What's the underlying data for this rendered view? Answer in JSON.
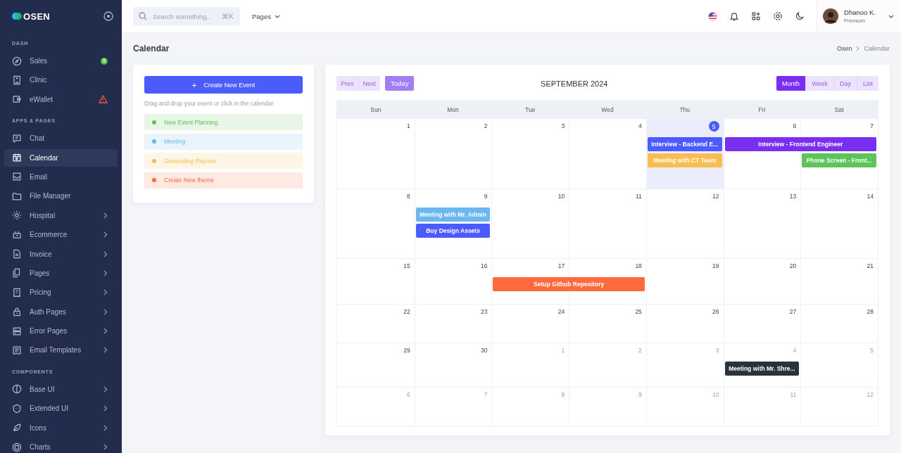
{
  "sidebar": {
    "logo": "OSEN",
    "sections": [
      {
        "title": "DASH",
        "items": [
          {
            "label": "Sales",
            "badge": "5",
            "warning": false,
            "has_submenu": false,
            "selected": false
          },
          {
            "label": "Clinic",
            "warning": false,
            "has_submenu": false,
            "selected": false
          },
          {
            "label": "eWallet",
            "warning": true,
            "has_submenu": false,
            "selected": false
          }
        ]
      },
      {
        "title": "APPS & PAGES",
        "items": [
          {
            "label": "Chat",
            "warning": false,
            "has_submenu": false,
            "selected": false
          },
          {
            "label": "Calendar",
            "warning": false,
            "has_submenu": false,
            "selected": true
          },
          {
            "label": "Email",
            "warning": false,
            "has_submenu": false,
            "selected": false
          },
          {
            "label": "File Manager",
            "warning": false,
            "has_submenu": false,
            "selected": false
          },
          {
            "label": "Hospital",
            "warning": false,
            "has_submenu": true,
            "selected": false
          },
          {
            "label": "Ecommerce",
            "warning": false,
            "has_submenu": true,
            "selected": false
          },
          {
            "label": "Invoice",
            "warning": false,
            "has_submenu": true,
            "selected": false
          },
          {
            "label": "Pages",
            "warning": false,
            "has_submenu": true,
            "selected": false
          },
          {
            "label": "Pricing",
            "warning": false,
            "has_submenu": true,
            "selected": false
          },
          {
            "label": "Auth Pages",
            "warning": false,
            "has_submenu": true,
            "selected": false
          },
          {
            "label": "Error Pages",
            "warning": false,
            "has_submenu": true,
            "selected": false
          },
          {
            "label": "Email Templates",
            "warning": false,
            "has_submenu": true,
            "selected": false
          }
        ]
      },
      {
        "title": "COMPONENTS",
        "items": [
          {
            "label": "Base UI",
            "warning": false,
            "has_submenu": true,
            "selected": false
          },
          {
            "label": "Extended UI",
            "warning": false,
            "has_submenu": true,
            "selected": false
          },
          {
            "label": "Icons",
            "warning": false,
            "has_submenu": true,
            "selected": false
          },
          {
            "label": "Charts",
            "warning": false,
            "has_submenu": true,
            "selected": false
          }
        ]
      }
    ]
  },
  "topbar": {
    "search": {
      "placeholder": "Search something..",
      "shortcut": "⌘K"
    },
    "menu": "Pages",
    "user": {
      "name": "Dhanoo K.",
      "role": "Premium"
    }
  },
  "page": {
    "title": "Calendar",
    "breadcrumb": [
      "Osen",
      "Calendar"
    ]
  },
  "events_panel": {
    "create_icon": "+",
    "create_button": "Create New Event",
    "hint": "Drag and drop your event or click in the calendar",
    "categories": [
      {
        "label": "New Event Planning",
        "color": "#5cc45a"
      },
      {
        "label": "Meeting",
        "color": "#6ab8ef"
      },
      {
        "label": "Generating Reports",
        "color": "#f9be4f"
      },
      {
        "label": "Create New theme",
        "color": "#ff6a3d"
      }
    ]
  },
  "calendar": {
    "nav": [
      "Prev",
      "Next"
    ],
    "today_button": "Today",
    "title": "SEPTEMBER 2024",
    "views": [
      {
        "label": "Month",
        "selected": true
      },
      {
        "label": "Week",
        "selected": false
      },
      {
        "label": "Day",
        "selected": false
      },
      {
        "label": "List",
        "selected": false
      }
    ],
    "weekdays": [
      "Sun",
      "Mon",
      "Tue",
      "Wed",
      "Thu",
      "Fri",
      "Sat"
    ],
    "weeks": [
      {
        "days": [
          {
            "label": "1",
            "other_month": false,
            "today": false
          },
          {
            "label": "2",
            "other_month": false,
            "today": false
          },
          {
            "label": "3",
            "other_month": false,
            "today": false
          },
          {
            "label": "4",
            "other_month": false,
            "today": false
          },
          {
            "label": "5",
            "other_month": false,
            "today": true,
            "events": [
              {
                "title": "Interview - Backend E...",
                "color": "#4a5cff",
                "extends_to_next_day": false
              },
              {
                "title": "Meeting with CT Team",
                "color": "#f9be4f",
                "extends_to_next_day": false
              }
            ]
          },
          {
            "label": "6",
            "other_month": false,
            "today": false,
            "events": [
              {
                "title": "Interview - Frontend Engineer",
                "color": "#7a2ff0",
                "extends_to_next_day": true
              }
            ]
          },
          {
            "label": "7",
            "other_month": false,
            "today": false,
            "events": [
              {
                "title": "Phone Screen - Front...",
                "color": "#5cc45a",
                "extends_to_next_day": false
              }
            ]
          }
        ]
      },
      {
        "days": [
          {
            "label": "8",
            "other_month": false,
            "today": false
          },
          {
            "label": "9",
            "other_month": false,
            "today": false,
            "events": [
              {
                "title": "Meeting with Mr. Admin",
                "color": "#6ab8ef",
                "extends_to_next_day": false
              },
              {
                "title": "Buy Design Assets",
                "color": "#4a5cff",
                "extends_to_next_day": false
              }
            ]
          },
          {
            "label": "10",
            "other_month": false,
            "today": false
          },
          {
            "label": "11",
            "other_month": false,
            "today": false
          },
          {
            "label": "12",
            "other_month": false,
            "today": false
          },
          {
            "label": "13",
            "other_month": false,
            "today": false
          },
          {
            "label": "14",
            "other_month": false,
            "today": false
          }
        ]
      },
      {
        "days": [
          {
            "label": "15",
            "other_month": false,
            "today": false
          },
          {
            "label": "16",
            "other_month": false,
            "today": false
          },
          {
            "label": "17",
            "other_month": false,
            "today": false,
            "events": [
              {
                "title": "Setup Github Repository",
                "color": "#ff6a3d",
                "extends_to_next_day": true
              }
            ]
          },
          {
            "label": "18",
            "other_month": false,
            "today": false
          },
          {
            "label": "19",
            "other_month": false,
            "today": false
          },
          {
            "label": "20",
            "other_month": false,
            "today": false
          },
          {
            "label": "21",
            "other_month": false,
            "today": false
          }
        ]
      },
      {
        "days": [
          {
            "label": "22",
            "other_month": false,
            "today": false
          },
          {
            "label": "23",
            "other_month": false,
            "today": false
          },
          {
            "label": "24",
            "other_month": false,
            "today": false
          },
          {
            "label": "25",
            "other_month": false,
            "today": false
          },
          {
            "label": "26",
            "other_month": false,
            "today": false
          },
          {
            "label": "27",
            "other_month": false,
            "today": false
          },
          {
            "label": "28",
            "other_month": false,
            "today": false
          }
        ]
      },
      {
        "days": [
          {
            "label": "29",
            "other_month": false,
            "today": false
          },
          {
            "label": "30",
            "other_month": false,
            "today": false
          },
          {
            "label": "1",
            "other_month": true,
            "today": false
          },
          {
            "label": "2",
            "other_month": true,
            "today": false
          },
          {
            "label": "3",
            "other_month": true,
            "today": false
          },
          {
            "label": "4",
            "other_month": true,
            "today": false,
            "events": [
              {
                "title": "Meeting with Mr. Shre...",
                "color": "#2b323e",
                "extends_to_next_day": false
              }
            ]
          },
          {
            "label": "5",
            "other_month": true,
            "today": false
          }
        ]
      },
      {
        "days": [
          {
            "label": "6",
            "other_month": true,
            "today": false
          },
          {
            "label": "7",
            "other_month": true,
            "today": false
          },
          {
            "label": "8",
            "other_month": true,
            "today": false
          },
          {
            "label": "9",
            "other_month": true,
            "today": false
          },
          {
            "label": "10",
            "other_month": true,
            "today": false
          },
          {
            "label": "11",
            "other_month": true,
            "today": false
          },
          {
            "label": "12",
            "other_month": true,
            "today": false
          }
        ]
      }
    ]
  }
}
